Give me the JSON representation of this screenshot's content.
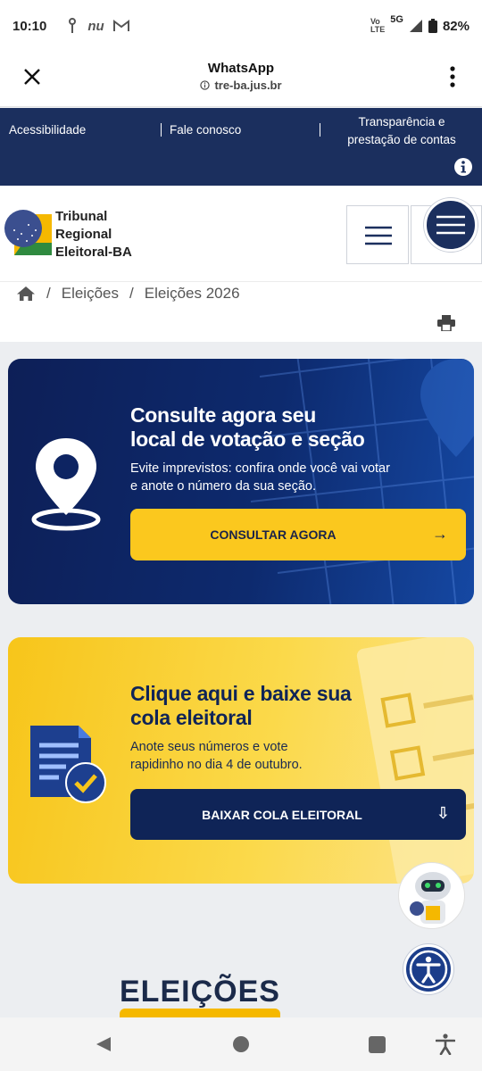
{
  "status_bar": {
    "time": "10:10",
    "notif_icons": [
      "usb-icon",
      "nu-icon",
      "gmail-icon"
    ],
    "nu_text": "nu",
    "network_label_top": "Vo",
    "network_label_bottom": "LTE",
    "network_type": "5G",
    "battery": "82%"
  },
  "browser": {
    "title": "WhatsApp",
    "url": "tre-ba.jus.br"
  },
  "top_nav": {
    "accessibility": "Acessibilidade",
    "contact": "Fale conosco",
    "transparency_line1": "Transparência e",
    "transparency_line2": "prestação de contas"
  },
  "logo": {
    "line1": "Tribunal",
    "line2": "Regional",
    "line3": "Eleitoral-BA"
  },
  "breadcrumb": {
    "items": [
      "Eleições",
      "Eleições 2026"
    ],
    "separator": "/"
  },
  "banner_polling": {
    "title_line1": "Consulte agora seu",
    "title_line2": "local de votação e seção",
    "text_line1": "Evite imprevistos: confira onde você vai votar",
    "text_line2": "e anote o número da sua seção.",
    "button": "CONSULTAR AGORA",
    "button_arrow": "→"
  },
  "banner_cola": {
    "title_line1": "Clique aqui e baixe sua",
    "title_line2": "cola eleitoral",
    "text_line1": "Anote seus números e vote",
    "text_line2": "rapidinho no dia 4 de outubro.",
    "button": "BAIXAR COLA ELEITORAL",
    "button_arrow": "⇩"
  },
  "footer_logo": {
    "text": "ELEIÇÕES"
  },
  "colors": {
    "navy": "#1b2f5e",
    "yellow": "#fbc81e"
  }
}
